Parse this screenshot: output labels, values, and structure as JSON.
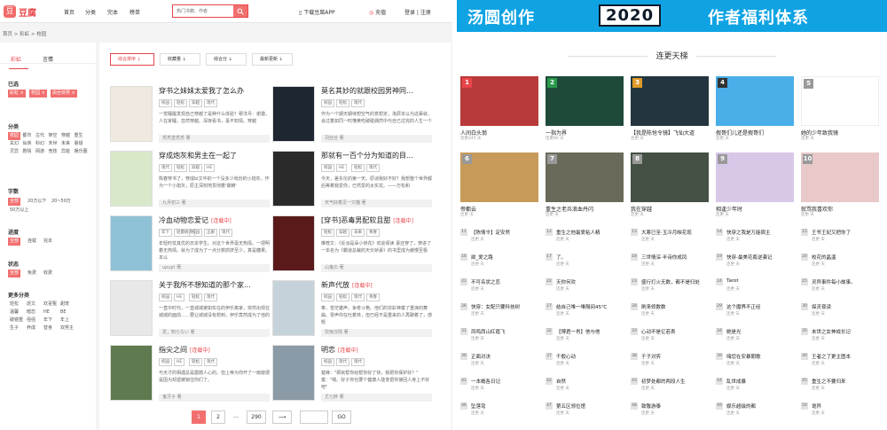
{
  "site": {
    "logo_text": "豆腐",
    "logo_mark": "豆"
  },
  "nav": [
    "首页",
    "分类",
    "完本",
    "榜单"
  ],
  "search": {
    "placeholder": "热门书籍、作者"
  },
  "header_links": {
    "download": "下载豆腐APP",
    "recharge": "充值",
    "login": "登录 | 注册"
  },
  "breadcrumb": "首页 > 彩虹 > 校园",
  "sidebar": {
    "tabs": [
      "彩虹",
      "言情"
    ],
    "selected_label": "已选",
    "selected": [
      "彩虹",
      "校园",
      "由全体男"
    ],
    "category_label": "分类",
    "categories": [
      "校园",
      "都市",
      "古代",
      "架空",
      "穿越",
      "重生",
      "玄幻",
      "仙侠",
      "科幻",
      "末世",
      "未来",
      "悬疑",
      "灵异",
      "剧情",
      "网游",
      "竞技",
      "异能",
      "娱乐圈"
    ],
    "words_label": "字数",
    "words": [
      "全部",
      "20万以下",
      "20~50万",
      "50万以上"
    ],
    "progress_label": "进度",
    "progress": [
      "全部",
      "连载",
      "完本"
    ],
    "status_label": "状态",
    "status": [
      "全部",
      "免费",
      "收费"
    ],
    "more_label": "更多分类",
    "more": [
      "轻松",
      "虐文",
      "欢喜冤",
      "甜宠",
      "温馨",
      "暗恋",
      "HE",
      "BE",
      "破镜重",
      "强强",
      "年下",
      "年上",
      "生子",
      "养成",
      "替身",
      "双男主"
    ]
  },
  "sort_buttons": [
    "综合排序 ↓",
    "收藏量 ↓",
    "综合分 ↓",
    "最新更新 ↓"
  ],
  "books": [
    {
      "title": "穿书之妹妹太爱我了怎么办",
      "status": "",
      "tags": [
        "校园",
        "轻松",
        "穿越",
        "现代"
      ],
      "desc": "一觉睡醒发现自己穿越了是种什么体验？穆淳月：谢邀，人在家睡，忽然穿越。深夜看书，毫不知情。穿越",
      "author": "秃秃皇秃秃 著",
      "cover": "#efe9df"
    },
    {
      "title": "莫名其妙的就跟校园男神同...",
      "status": "",
      "tags": [
        "校园",
        "轻松",
        "现代"
      ],
      "desc": "作为一个期天期待想空气的意想定，洛辰本以为这辈就，会过着如同一时懂黄吃破碰偶然中与自己过完的人生一个",
      "author": "羽丝丝 著",
      "cover": "#1e2632"
    },
    {
      "title": "穿成炮灰和男主在一起了",
      "status": "",
      "tags": [
        "现代",
        "轻松",
        "穿越",
        "HE"
      ],
      "desc": "陈春穿书了，穿成bl文中的一个没多少戏份的小炮灰。作为一个小炮灰，原主深刻地贯彻着'做精'",
      "author": "九月初三 著",
      "cover": "#d9e8c9"
    },
    {
      "title": "那就有一百个分为知道的目...",
      "status": "",
      "tags": [
        "校园",
        "HE",
        "轻松",
        "现代"
      ],
      "desc": "今天，差东伦的第一天。原谅我好不好？我想整个世界都后等着我爱你，已然爱的太实龙。——万松和",
      "author": "天气好着见一只猫 著",
      "cover": "#2a2a2a"
    },
    {
      "title": "冷血动物恋爱记",
      "status": "[连载中]",
      "tags": [
        "年下",
        "轻量搞笑",
        "校园",
        "正剧",
        "现代"
      ],
      "desc": "年轻时仗其优的日本学生。对这个世界毫无热情。一把明着无热情。就为了成为了一点分数抓挤至少，真是糖果。本以",
      "author": "upup! 著",
      "cover": "#8fc1d6"
    },
    {
      "title": "[穿书]恶毒男配软且甜",
      "status": "[连载中]",
      "tags": [
        "轻松",
        "穿越",
        "未来",
        "青春"
      ],
      "desc": "推荐文：《反派是朵小娇花》欢迎阅读 妻还穿了，穿进了一本名为《霸道总裁的天价娇妻》的书里成为傲慢至极",
      "author": "山鬼の 著",
      "cover": "#5a1a1a"
    },
    {
      "title": "关于我所不想知道的那个家...",
      "status": "",
      "tags": [
        "校园",
        "HE",
        "轻松",
        "现代"
      ],
      "desc": "一直中时代，一直城城被如实在的伊乐离家。突然出现在城城的面前……要让城城没有想到，伊乐竟然成为了他的",
      "author": "爱，知らない 著",
      "cover": "#e8e8e8"
    },
    {
      "title": "新声代放",
      "status": "[连载中]",
      "tags": [
        "校园",
        "轻松",
        "现代",
        "青春"
      ],
      "desc": "奉、苍茫雄声，争奇斗艳。他们的非彩神童了重演的舞曲。零声你在吐着林，但已经不是重来的人再聊着了，感慨",
      "author": "饮雨汉情 著",
      "cover": "#c6d2da"
    },
    {
      "title": "指尖之间",
      "status": "[连载中]",
      "tags": [
        "校园",
        "HE",
        "轻松",
        "现代"
      ],
      "desc": "与天才的相遇总是震撼人心的。但上帝为你开了一扇窗便是因为却遗被锁住你们了。",
      "author": "鬼牙子 著",
      "cover": "#5f7a4e"
    },
    {
      "title": "明恋",
      "status": "[连载中]",
      "tags": [
        "校园",
        "现代",
        "现代"
      ],
      "desc": "楚峰：\"那就帮你给帮你好了快，我把你保护好？\" 童：\"嗯。好子你也要个健康人能变把你接回人身上不好吧\"",
      "author": "尤七胖 著",
      "cover": "#8a9aa6"
    }
  ],
  "pagination": {
    "current": "1",
    "pages": [
      "1",
      "2",
      "...",
      "290",
      "⟶"
    ],
    "go": "GO"
  },
  "banner": {
    "part1": "汤圆创作",
    "year": "2020",
    "part2": "作者福利体系"
  },
  "rank_title": "连更天梯",
  "top_cards": [
    {
      "rank": "1",
      "name": "人间白头翁",
      "days": "连更245 天",
      "cover": "#b83a3a",
      "rcolor": "#e8454a"
    },
    {
      "rank": "2",
      "name": "一指为界",
      "days": "连更80 天",
      "cover": "#1f4a3a",
      "rcolor": "#2a9a4a"
    },
    {
      "rank": "3",
      "name": "【我是陈怆令镜】飞仙大道",
      "days": "连更 天",
      "cover": "#23363f",
      "rcolor": "#e09a2a"
    },
    {
      "rank": "4",
      "name": "假哥们儿还是假哥们",
      "days": "连更 天",
      "cover": "#4aaee8",
      "rcolor": "#333"
    },
    {
      "rank": "5",
      "name": "她的少年致我镜",
      "days": "连更 天",
      "cover": "#ffffff",
      "rcolor": "#999"
    },
    {
      "rank": "6",
      "name": "帝都云",
      "days": "连更 天",
      "cover": "#c89a5a",
      "rcolor": "#999"
    },
    {
      "rank": "7",
      "name": "重生之老兵浪血丹闪",
      "days": "连更 天",
      "cover": "#6a6a5a",
      "rcolor": "#999"
    },
    {
      "rank": "8",
      "name": "我在穿越",
      "days": "连更 天",
      "cover": "#445044",
      "rcolor": "#999"
    },
    {
      "rank": "9",
      "name": "相逢少年时",
      "days": "连更 天",
      "cover": "#d8c8e8",
      "rcolor": "#999"
    },
    {
      "rank": "10",
      "name": "就骂我喜欢你",
      "days": "连更 天",
      "cover": "#e8c8c8",
      "rcolor": "#999"
    }
  ],
  "list_cols": [
    [
      {
        "n": "11",
        "t": "【陈情令】定安然",
        "d": "连更 天"
      },
      {
        "n": "16",
        "t": "欲_爱之路",
        "d": "连更 天"
      },
      {
        "n": "21",
        "t": "不可名状之恋",
        "d": "连更 天"
      },
      {
        "n": "26",
        "t": "快穿：女配只要科技树",
        "d": "连更 天"
      },
      {
        "n": "31",
        "t": "凤鸣西山红霞飞",
        "d": "连更 天"
      },
      {
        "n": "36",
        "t": "正面对决",
        "d": "连更 天"
      },
      {
        "n": "41",
        "t": "一本概各日记",
        "d": "连更 天"
      },
      {
        "n": "46",
        "t": "坠落穹",
        "d": "连更 天"
      }
    ],
    [
      {
        "n": "12",
        "t": "重生之他最爱粘人精",
        "d": "连更 天"
      },
      {
        "n": "17",
        "t": "了。",
        "d": "连更 天"
      },
      {
        "n": "22",
        "t": "天你何欢",
        "d": "连更 天"
      },
      {
        "n": "27",
        "t": "结自己唯一唯隔间45℃",
        "d": "连更 天"
      },
      {
        "n": "32",
        "t": "【博君一肖】他与他",
        "d": "连更 天"
      },
      {
        "n": "37",
        "t": "千般心动",
        "d": "连更 天"
      },
      {
        "n": "42",
        "t": "自然",
        "d": "连更 天"
      },
      {
        "n": "47",
        "t": "第五区领位馆",
        "d": "连更 天"
      }
    ],
    [
      {
        "n": "13",
        "t": "大寒已至·玉冷月映花现",
        "d": "连更 天"
      },
      {
        "n": "18",
        "t": "三世情深·半诗你成凤",
        "d": "连更 天"
      },
      {
        "n": "23",
        "t": "盛行灯火无数，都不是归处",
        "d": "连更 天"
      },
      {
        "n": "28",
        "t": "刷来修数数",
        "d": "连更 天"
      },
      {
        "n": "33",
        "t": "心动不是亿若表",
        "d": "连更 天"
      },
      {
        "n": "38",
        "t": "于子对弈",
        "d": "连更 天"
      },
      {
        "n": "43",
        "t": "初梦处都的两段人生",
        "d": "连更 天"
      },
      {
        "n": "48",
        "t": "致敬游泰",
        "d": "连更 天"
      }
    ],
    [
      {
        "n": "14",
        "t": "快穿之我是万能宿主",
        "d": "连更 天"
      },
      {
        "n": "19",
        "t": "快穿-最美花瓶逆袭记",
        "d": "连更 天"
      },
      {
        "n": "24",
        "t": "Tarot",
        "d": "连更 天"
      },
      {
        "n": "29",
        "t": "这个魔界不正经",
        "d": "连更 天"
      },
      {
        "n": "34",
        "t": "她是光",
        "d": "连更 天"
      },
      {
        "n": "39",
        "t": "嗨您在安暴朝歌",
        "d": "连更 天"
      },
      {
        "n": "44",
        "t": "乱世成暴",
        "d": "连更 天"
      },
      {
        "n": "49",
        "t": "娱乐超级的都",
        "d": "连更 天"
      }
    ],
    [
      {
        "n": "15",
        "t": "王爷王妃又把你了",
        "d": "连更 天"
      },
      {
        "n": "20",
        "t": "校花的晶温",
        "d": "连更 天"
      },
      {
        "n": "25",
        "t": "灵异事件每小故事。",
        "d": "连更 天"
      },
      {
        "n": "30",
        "t": "探灵夜读",
        "d": "连更 天"
      },
      {
        "n": "35",
        "t": "末世之女神成长记",
        "d": "连更 天"
      },
      {
        "n": "40",
        "t": "王者之了更主图本",
        "d": "连更 天"
      },
      {
        "n": "45",
        "t": "重生之不要归来",
        "d": "连更 天"
      },
      {
        "n": "50",
        "t": "诡异",
        "d": "连更 天"
      }
    ]
  ]
}
